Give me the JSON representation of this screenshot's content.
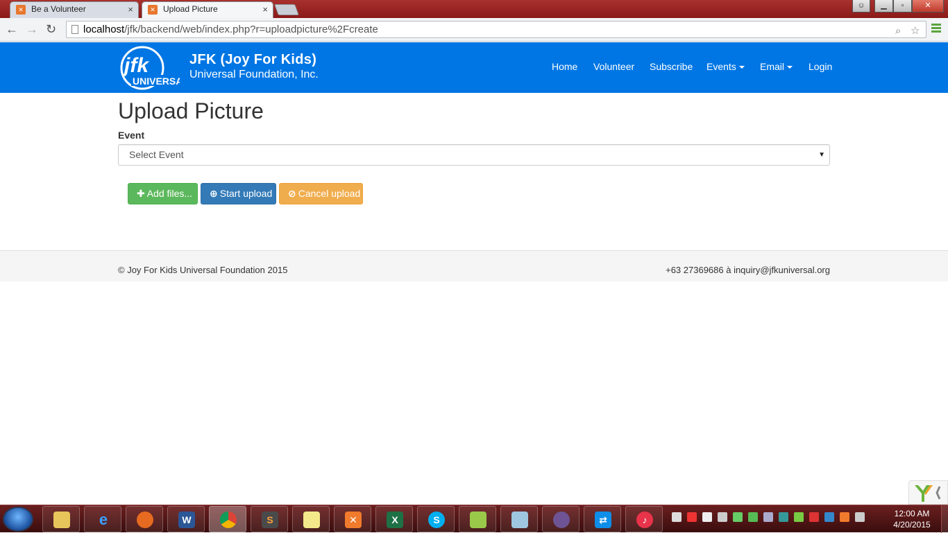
{
  "browser": {
    "tabs": [
      {
        "title": "Be a Volunteer",
        "active": false
      },
      {
        "title": "Upload Picture",
        "active": true
      }
    ],
    "url_host": "localhost",
    "url_path": "/jfk/backend/web/index.php?r=uploadpicture%2Fcreate"
  },
  "navbar": {
    "brand_title": "JFK (Joy For Kids)",
    "brand_subtitle": "Universal Foundation, Inc.",
    "logo_text": "jfk",
    "logo_band": "UNIVERSAL",
    "links": [
      {
        "label": "Home",
        "dropdown": false
      },
      {
        "label": "Volunteer",
        "dropdown": false
      },
      {
        "label": "Subscribe",
        "dropdown": false
      },
      {
        "label": "Events",
        "dropdown": true
      },
      {
        "label": "Email",
        "dropdown": true
      },
      {
        "label": "Login",
        "dropdown": false
      }
    ],
    "color": "#0076e4"
  },
  "main": {
    "title": "Upload Picture",
    "event_label": "Event",
    "event_select_value": "Select Event",
    "buttons": {
      "add": "Add files...",
      "start": "Start upload",
      "cancel": "Cancel upload"
    }
  },
  "footer": {
    "left": "© Joy For Kids Universal Foundation 2015",
    "right": "+63 27369686 à inquiry@jfkuniversal.org"
  },
  "taskbar": {
    "time": "12:00 AM",
    "date": "4/20/2015"
  }
}
